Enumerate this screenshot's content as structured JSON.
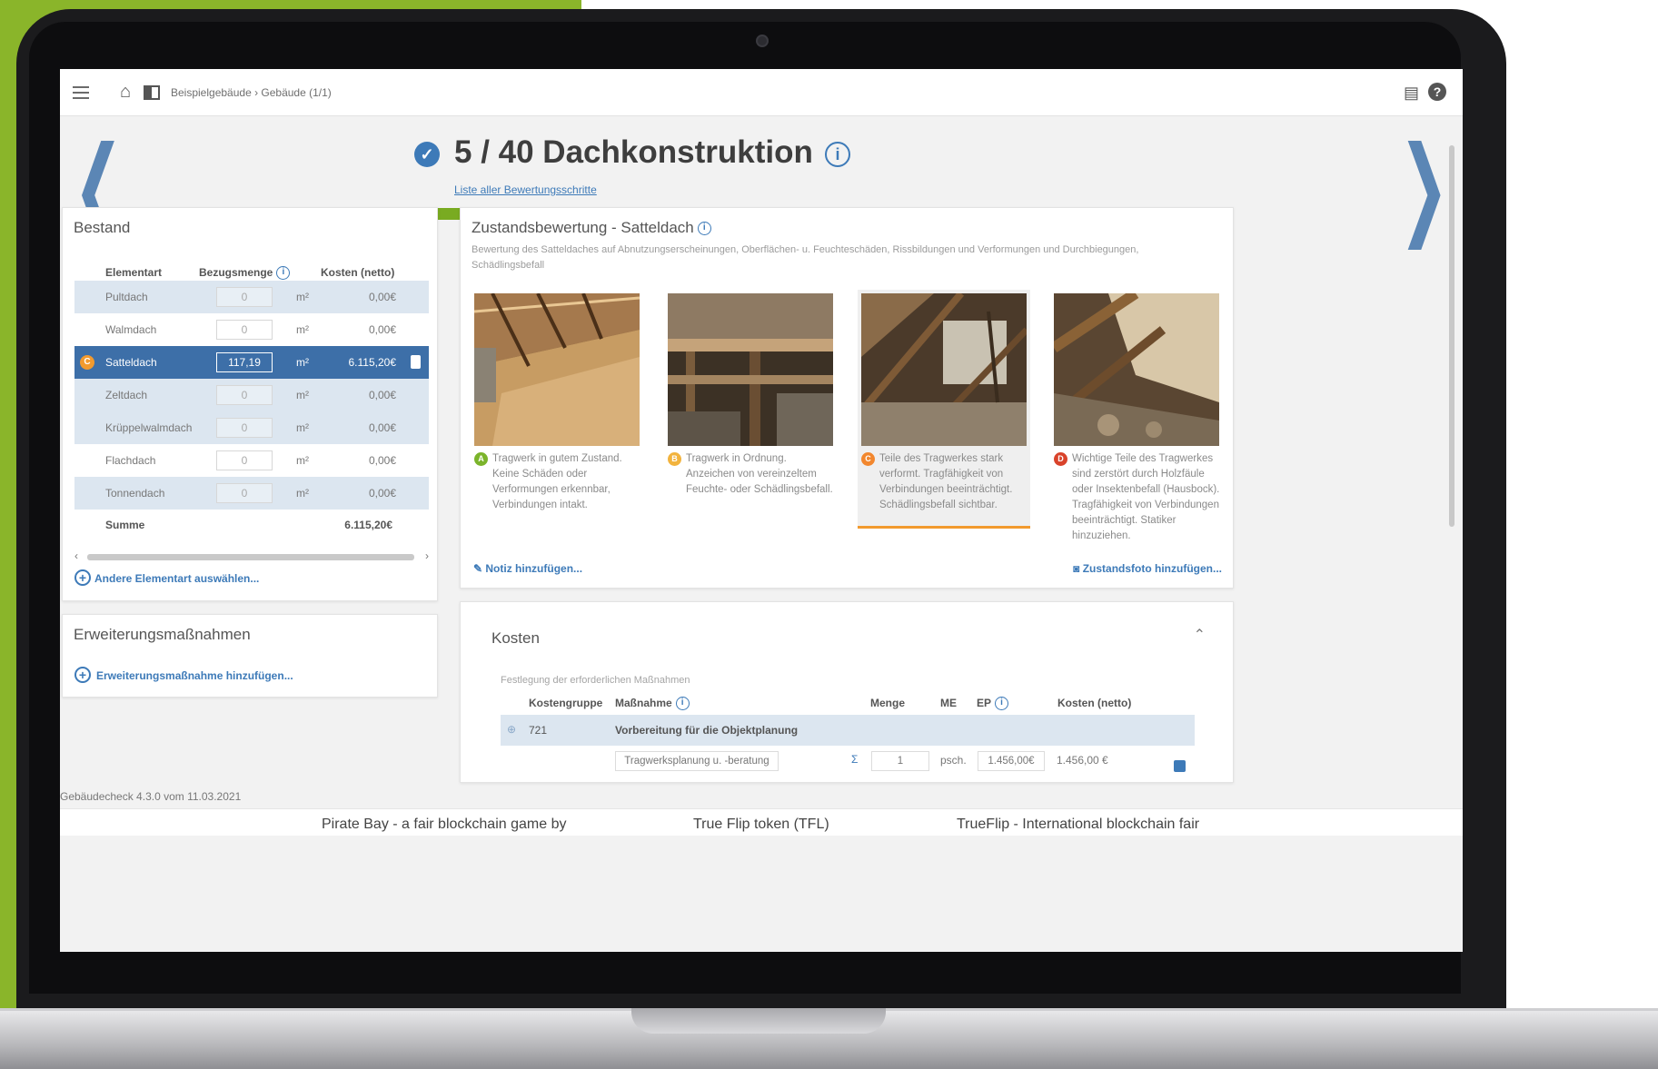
{
  "topbar": {
    "breadcrumb": "Beispielgebäude › Gebäude (1/1)"
  },
  "step": {
    "title": "5 / 40 Dachkonstruktion",
    "list_link": "Liste aller Bewertungsschritte",
    "progress": 0.125
  },
  "bestand": {
    "title": "Bestand",
    "headers": [
      "Elementart",
      "Bezugsmenge",
      "Kosten (netto)"
    ],
    "rows": [
      {
        "name": "Pultdach",
        "qty": "0",
        "unit": "m²",
        "cost": "0,00€"
      },
      {
        "name": "Walmdach",
        "qty": "0",
        "unit": "m²",
        "cost": "0,00€"
      },
      {
        "name": "Satteldach",
        "qty": "117,19",
        "unit": "m²",
        "cost": "6.115,20€",
        "rating": "C"
      },
      {
        "name": "Zeltdach",
        "qty": "0",
        "unit": "m²",
        "cost": "0,00€"
      },
      {
        "name": "Krüppelwalmdach",
        "qty": "0",
        "unit": "m²",
        "cost": "0,00€"
      },
      {
        "name": "Flachdach",
        "qty": "0",
        "unit": "m²",
        "cost": "0,00€"
      },
      {
        "name": "Tonnendach",
        "qty": "0",
        "unit": "m²",
        "cost": "0,00€"
      }
    ],
    "sum_label": "Summe",
    "sum_value": "6.115,20€",
    "add_link": "Andere Elementart auswählen..."
  },
  "erweiterung": {
    "title": "Erweiterungsmaßnahmen",
    "add_link": "Erweiterungsmaßnahme hinzufügen..."
  },
  "zustand": {
    "title": "Zustandsbewertung - Satteldach",
    "description": "Bewertung des Satteldaches auf Abnutzungserscheinungen, Oberflächen- u. Feuchteschäden, Rissbildungen und Verformungen und Durchbiegungen, Schädlingsbefall",
    "options": [
      {
        "badge": "A",
        "color": "#7bb42b",
        "text": "Tragwerk in gutem Zustand. Keine Schäden oder Verformungen erkennbar, Verbindungen intakt."
      },
      {
        "badge": "B",
        "color": "#f2b33d",
        "text": "Tragwerk in Ordnung. Anzeichen von vereinzeltem Feuchte- oder Schädlingsbefall."
      },
      {
        "badge": "C",
        "color": "#f2872e",
        "text": "Teile des Tragwerkes stark verformt. Tragfähigkeit von Verbindungen beeinträchtigt. Schädlingsbefall sichtbar."
      },
      {
        "badge": "D",
        "color": "#d9432b",
        "text": "Wichtige Teile des Tragwerkes sind zerstört durch Holzfäule oder Insektenbefall (Hausbock). Tragfähigkeit von Verbindungen beeinträchtigt. Statiker hinzuziehen."
      }
    ],
    "note_link": "Notiz hinzufügen...",
    "photo_link": "Zustandsfoto hinzufügen..."
  },
  "kosten": {
    "title": "Kosten",
    "subtitle": "Festlegung der erforderlichen Maßnahmen",
    "headers": [
      "Kostengruppe",
      "Maßnahme",
      "Menge",
      "ME",
      "EP",
      "Kosten (netto)"
    ],
    "group": {
      "code": "721",
      "name": "Vorbereitung für die Objektplanung"
    },
    "item": {
      "name": "Tragwerksplanung u. -beratung",
      "sigma": "Σ",
      "menge": "1",
      "me": "psch.",
      "ep": "1.456,00€",
      "kosten": "1.456,00 €"
    }
  },
  "footer": {
    "version": "Gebäudecheck 4.3.0 vom 11.03.2021",
    "ticker": [
      "Pirate Bay - a fair blockchain game by",
      "True Flip token (TFL)",
      "TrueFlip - International blockchain fair"
    ]
  },
  "colors": {
    "brand_green": "#8ab52a",
    "accent_blue": "#3d7ab8",
    "selected_row": "#3d6fa8",
    "active_rating": "#f29a2e"
  }
}
